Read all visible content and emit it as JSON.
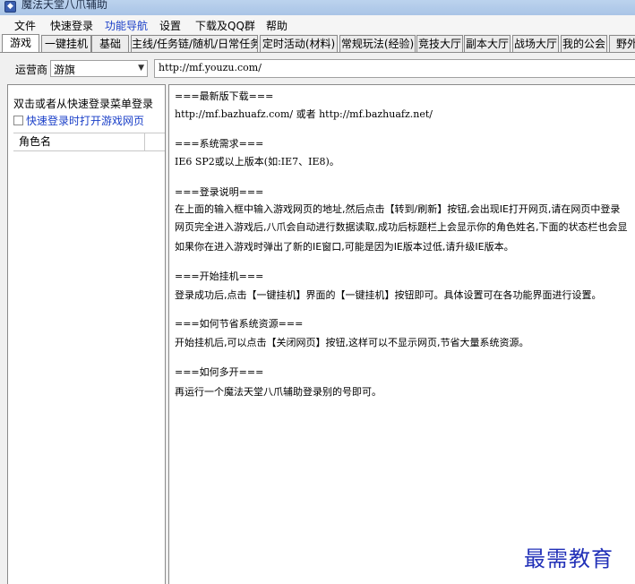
{
  "window": {
    "title": "魔法天堂八爪辅助"
  },
  "menu": [
    {
      "label": "文件"
    },
    {
      "label": "快速登录"
    },
    {
      "label": "功能导航",
      "active": true
    },
    {
      "label": "设置"
    },
    {
      "label": "下载及QQ群"
    },
    {
      "label": "帮助"
    }
  ],
  "tabs": [
    {
      "label": "游戏",
      "active": true
    },
    {
      "label": "一键挂机"
    },
    {
      "label": "基础"
    },
    {
      "label": "主线/任务链/随机/日常任务"
    },
    {
      "label": "定时活动(材料)"
    },
    {
      "label": "常规玩法(经验)"
    },
    {
      "label": "竞技大厅"
    },
    {
      "label": "副本大厅"
    },
    {
      "label": "战场大厅"
    },
    {
      "label": "我的公会"
    },
    {
      "label": "野外"
    }
  ],
  "operator": {
    "label": "运营商",
    "value": "游旗"
  },
  "url": {
    "value": "http://mf.youzu.com/"
  },
  "left": {
    "hint": "双击或者从快速登录菜单登录",
    "checkbox_label": "快速登录时打开游戏网页",
    "checkbox_checked": false,
    "column_header": "角色名"
  },
  "content": {
    "lines": [
      "===最新版下载===",
      "http://mf.bazhuafz.com/ 或者 http://mf.bazhuafz.net/",
      "===系统需求===",
      "IE6 SP2或以上版本(如:IE7、IE8)。",
      "===登录说明===",
      "在上面的输入框中输入游戏网页的地址,然后点击【转到/刷新】按钮,会出现IE打开网页,请在网页中登录",
      "网页完全进入游戏后,八爪会自动进行数据读取,成功后标题栏上会显示你的角色姓名,下面的状态栏也会显",
      "如果你在进入游戏时弹出了新的IE窗口,可能是因为IE版本过低,请升级IE版本。",
      "===开始挂机===",
      "登录成功后,点击【一键挂机】界面的【一键挂机】按钮即可。具体设置可在各功能界面进行设置。",
      "===如何节省系统资源===",
      "开始挂机后,可以点击【关闭网页】按钮,这样可以不显示网页,节省大量系统资源。",
      "===如何多开===",
      "再运行一个魔法天堂八爪辅助登录别的号即可。"
    ]
  },
  "watermark": "最需教育"
}
